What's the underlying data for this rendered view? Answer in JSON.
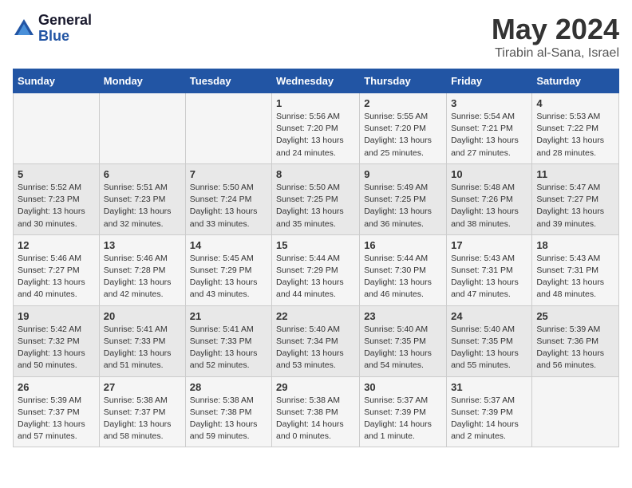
{
  "logo": {
    "general": "General",
    "blue": "Blue"
  },
  "title": "May 2024",
  "location": "Tirabin al-Sana, Israel",
  "days_header": [
    "Sunday",
    "Monday",
    "Tuesday",
    "Wednesday",
    "Thursday",
    "Friday",
    "Saturday"
  ],
  "weeks": [
    [
      {
        "day": "",
        "info": ""
      },
      {
        "day": "",
        "info": ""
      },
      {
        "day": "",
        "info": ""
      },
      {
        "day": "1",
        "info": "Sunrise: 5:56 AM\nSunset: 7:20 PM\nDaylight: 13 hours\nand 24 minutes."
      },
      {
        "day": "2",
        "info": "Sunrise: 5:55 AM\nSunset: 7:20 PM\nDaylight: 13 hours\nand 25 minutes."
      },
      {
        "day": "3",
        "info": "Sunrise: 5:54 AM\nSunset: 7:21 PM\nDaylight: 13 hours\nand 27 minutes."
      },
      {
        "day": "4",
        "info": "Sunrise: 5:53 AM\nSunset: 7:22 PM\nDaylight: 13 hours\nand 28 minutes."
      }
    ],
    [
      {
        "day": "5",
        "info": "Sunrise: 5:52 AM\nSunset: 7:23 PM\nDaylight: 13 hours\nand 30 minutes."
      },
      {
        "day": "6",
        "info": "Sunrise: 5:51 AM\nSunset: 7:23 PM\nDaylight: 13 hours\nand 32 minutes."
      },
      {
        "day": "7",
        "info": "Sunrise: 5:50 AM\nSunset: 7:24 PM\nDaylight: 13 hours\nand 33 minutes."
      },
      {
        "day": "8",
        "info": "Sunrise: 5:50 AM\nSunset: 7:25 PM\nDaylight: 13 hours\nand 35 minutes."
      },
      {
        "day": "9",
        "info": "Sunrise: 5:49 AM\nSunset: 7:25 PM\nDaylight: 13 hours\nand 36 minutes."
      },
      {
        "day": "10",
        "info": "Sunrise: 5:48 AM\nSunset: 7:26 PM\nDaylight: 13 hours\nand 38 minutes."
      },
      {
        "day": "11",
        "info": "Sunrise: 5:47 AM\nSunset: 7:27 PM\nDaylight: 13 hours\nand 39 minutes."
      }
    ],
    [
      {
        "day": "12",
        "info": "Sunrise: 5:46 AM\nSunset: 7:27 PM\nDaylight: 13 hours\nand 40 minutes."
      },
      {
        "day": "13",
        "info": "Sunrise: 5:46 AM\nSunset: 7:28 PM\nDaylight: 13 hours\nand 42 minutes."
      },
      {
        "day": "14",
        "info": "Sunrise: 5:45 AM\nSunset: 7:29 PM\nDaylight: 13 hours\nand 43 minutes."
      },
      {
        "day": "15",
        "info": "Sunrise: 5:44 AM\nSunset: 7:29 PM\nDaylight: 13 hours\nand 44 minutes."
      },
      {
        "day": "16",
        "info": "Sunrise: 5:44 AM\nSunset: 7:30 PM\nDaylight: 13 hours\nand 46 minutes."
      },
      {
        "day": "17",
        "info": "Sunrise: 5:43 AM\nSunset: 7:31 PM\nDaylight: 13 hours\nand 47 minutes."
      },
      {
        "day": "18",
        "info": "Sunrise: 5:43 AM\nSunset: 7:31 PM\nDaylight: 13 hours\nand 48 minutes."
      }
    ],
    [
      {
        "day": "19",
        "info": "Sunrise: 5:42 AM\nSunset: 7:32 PM\nDaylight: 13 hours\nand 50 minutes."
      },
      {
        "day": "20",
        "info": "Sunrise: 5:41 AM\nSunset: 7:33 PM\nDaylight: 13 hours\nand 51 minutes."
      },
      {
        "day": "21",
        "info": "Sunrise: 5:41 AM\nSunset: 7:33 PM\nDaylight: 13 hours\nand 52 minutes."
      },
      {
        "day": "22",
        "info": "Sunrise: 5:40 AM\nSunset: 7:34 PM\nDaylight: 13 hours\nand 53 minutes."
      },
      {
        "day": "23",
        "info": "Sunrise: 5:40 AM\nSunset: 7:35 PM\nDaylight: 13 hours\nand 54 minutes."
      },
      {
        "day": "24",
        "info": "Sunrise: 5:40 AM\nSunset: 7:35 PM\nDaylight: 13 hours\nand 55 minutes."
      },
      {
        "day": "25",
        "info": "Sunrise: 5:39 AM\nSunset: 7:36 PM\nDaylight: 13 hours\nand 56 minutes."
      }
    ],
    [
      {
        "day": "26",
        "info": "Sunrise: 5:39 AM\nSunset: 7:37 PM\nDaylight: 13 hours\nand 57 minutes."
      },
      {
        "day": "27",
        "info": "Sunrise: 5:38 AM\nSunset: 7:37 PM\nDaylight: 13 hours\nand 58 minutes."
      },
      {
        "day": "28",
        "info": "Sunrise: 5:38 AM\nSunset: 7:38 PM\nDaylight: 13 hours\nand 59 minutes."
      },
      {
        "day": "29",
        "info": "Sunrise: 5:38 AM\nSunset: 7:38 PM\nDaylight: 14 hours\nand 0 minutes."
      },
      {
        "day": "30",
        "info": "Sunrise: 5:37 AM\nSunset: 7:39 PM\nDaylight: 14 hours\nand 1 minute."
      },
      {
        "day": "31",
        "info": "Sunrise: 5:37 AM\nSunset: 7:39 PM\nDaylight: 14 hours\nand 2 minutes."
      },
      {
        "day": "",
        "info": ""
      }
    ]
  ]
}
